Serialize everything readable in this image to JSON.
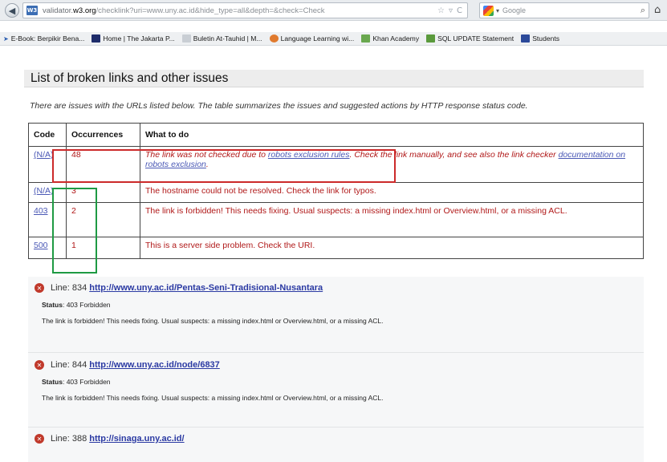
{
  "browser": {
    "url_host": "validator.w3.org",
    "url_rest": "/checklink?uri=www.uny.ac.id&hide_type=all&depth=&check=Check",
    "url_prefix": "validator.",
    "url_host_bold": "w3.org",
    "search_engine": "Google",
    "bookmarks": [
      {
        "label": "E-Book: Berpikir Bena...",
        "color": "#2a5db0"
      },
      {
        "label": "Home | The Jakarta P...",
        "color": "#1f2d6b"
      },
      {
        "label": "Buletin At-Tauhid | M...",
        "color": "#9aa3ad"
      },
      {
        "label": "Language Learning wi...",
        "color": "#e07a2e"
      },
      {
        "label": "Khan Academy",
        "color": "#6aa84f"
      },
      {
        "label": "SQL UPDATE Statement",
        "color": "#5a9a3c"
      },
      {
        "label": "Students",
        "color": "#2c4a9a"
      }
    ]
  },
  "page": {
    "heading": "List of broken links and other issues",
    "intro": "There are issues with the URLs listed below. The table summarizes the issues and suggested actions by HTTP response status code.",
    "table": {
      "headers": [
        "Code",
        "Occurrences",
        "What to do"
      ],
      "rows": [
        {
          "code": "(N/A)",
          "occurrences": "48",
          "text_1": "The link was not checked due to ",
          "link_1": "robots exclusion rules",
          "text_2": ". Check the link manually, and see also the link checker ",
          "link_2": "documentation on robots exclusion",
          "text_3": "."
        },
        {
          "code": "(N/A)",
          "occurrences": "3",
          "text": "The hostname could not be resolved. Check the link for typos."
        },
        {
          "code": "403",
          "occurrences": "2",
          "text": "The link is forbidden! This needs fixing. Usual suspects: a missing index.html or Overview.html, or a missing ACL."
        },
        {
          "code": "500",
          "occurrences": "1",
          "text": "This is a server side problem. Check the URI."
        }
      ]
    },
    "details": [
      {
        "line_label": "Line:",
        "line": "834",
        "url": "http://www.uny.ac.id/Pentas-Seni-Tradisional-Nusantara",
        "status_label": "Status",
        "status": ": 403 Forbidden",
        "message": "The link is forbidden! This needs fixing. Usual suspects: a missing index.html or Overview.html, or a missing ACL."
      },
      {
        "line_label": "Line:",
        "line": "844",
        "url": "http://www.uny.ac.id/node/6837",
        "status_label": "Status",
        "status": ": 403 Forbidden",
        "message": "The link is forbidden! This needs fixing. Usual suspects: a missing index.html or Overview.html, or a missing ACL."
      },
      {
        "line_label": "Line:",
        "line": "388",
        "url": "http://sinaga.uny.ac.id/"
      }
    ]
  },
  "colors": {
    "annotation_red": "#cc2a2a",
    "annotation_green": "#1e9a43",
    "issue_text": "#b01818",
    "link": "#4a58b5"
  }
}
